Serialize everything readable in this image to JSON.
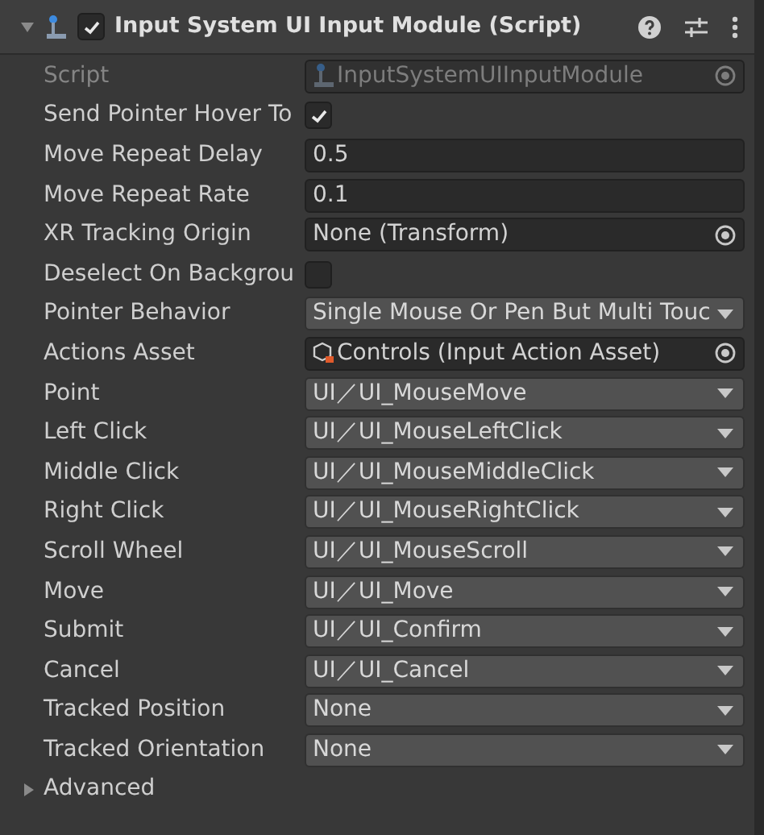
{
  "header": {
    "title": "Input System UI Input Module (Script)",
    "enabled": true,
    "expanded": true
  },
  "properties": [
    {
      "kind": "script",
      "label": "Script",
      "value": "InputSystemUIInputModule",
      "disabled": true
    },
    {
      "kind": "checkbox",
      "label": "Send Pointer Hover To",
      "checked": true
    },
    {
      "kind": "text",
      "label": "Move Repeat Delay",
      "value": "0.5"
    },
    {
      "kind": "text",
      "label": "Move Repeat Rate",
      "value": "0.1"
    },
    {
      "kind": "object",
      "label": "XR Tracking Origin",
      "value": "None (Transform)",
      "disabled": false
    },
    {
      "kind": "checkbox",
      "label": "Deselect On Backgrou",
      "checked": false
    },
    {
      "kind": "dropdown",
      "label": "Pointer Behavior",
      "value": "Single Mouse Or Pen But Multi Touc"
    },
    {
      "kind": "asset",
      "label": "Actions Asset",
      "value": "Controls (Input Action Asset)",
      "disabled": false
    },
    {
      "kind": "dropdown",
      "label": "Point",
      "value": "UI／UI_MouseMove"
    },
    {
      "kind": "dropdown",
      "label": "Left Click",
      "value": "UI／UI_MouseLeftClick"
    },
    {
      "kind": "dropdown",
      "label": "Middle Click",
      "value": "UI／UI_MouseMiddleClick"
    },
    {
      "kind": "dropdown",
      "label": "Right Click",
      "value": "UI／UI_MouseRightClick"
    },
    {
      "kind": "dropdown",
      "label": "Scroll Wheel",
      "value": "UI／UI_MouseScroll"
    },
    {
      "kind": "dropdown",
      "label": "Move",
      "value": "UI／UI_Move"
    },
    {
      "kind": "dropdown",
      "label": "Submit",
      "value": "UI／UI_Confirm"
    },
    {
      "kind": "dropdown",
      "label": "Cancel",
      "value": "UI／UI_Cancel"
    },
    {
      "kind": "dropdown",
      "label": "Tracked Position",
      "value": "None"
    },
    {
      "kind": "dropdown",
      "label": "Tracked Orientation",
      "value": "None"
    }
  ],
  "advanced": {
    "label": "Advanced",
    "expanded": false
  }
}
